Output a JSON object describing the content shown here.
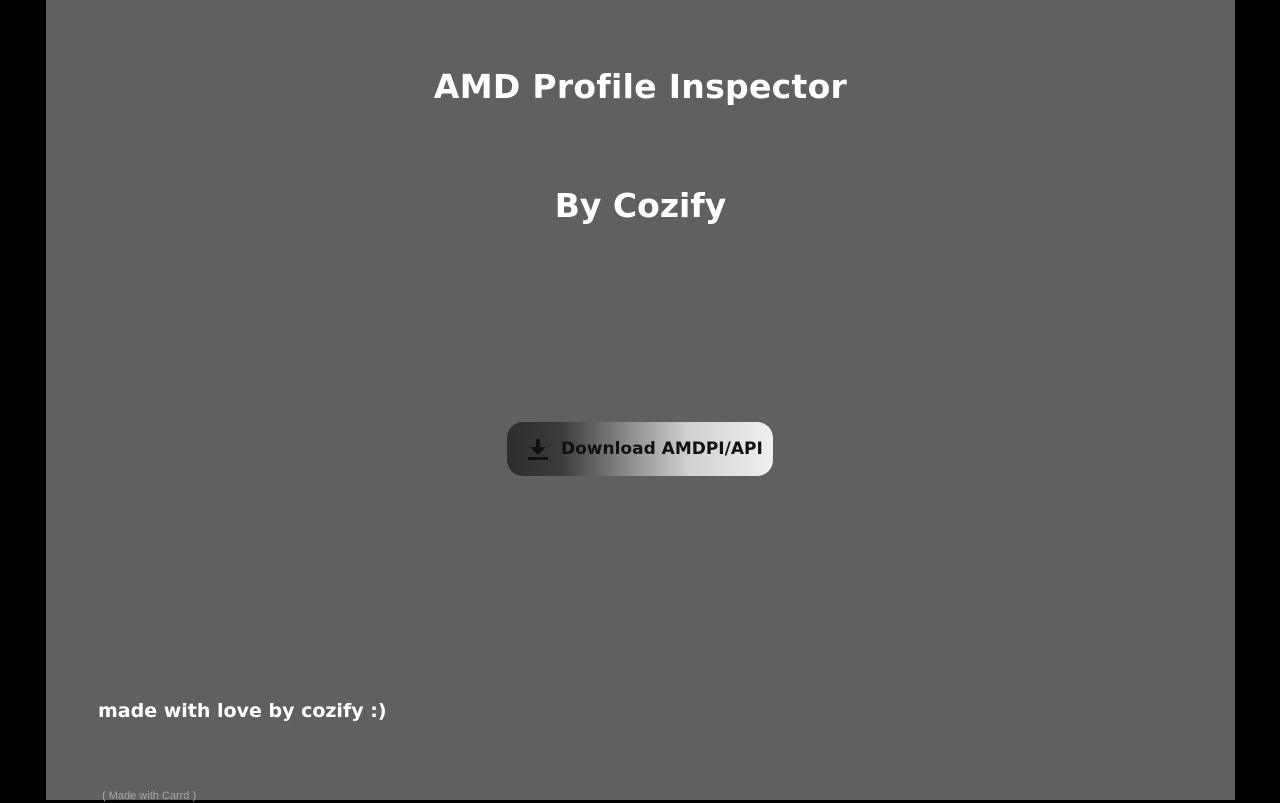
{
  "header": {
    "title": "AMD Profile Inspector",
    "subtitle": "By Cozify"
  },
  "download": {
    "label": "Download AMDPI/API",
    "icon": "download-icon"
  },
  "footer": {
    "love_text": "made with love by cozify :)",
    "carrd_open": "( ",
    "carrd_link": "Made with Carrd",
    "carrd_close": " )"
  },
  "colors": {
    "background": "#606060",
    "side_bars": "#000000",
    "text": "#ffffff",
    "button_text": "#111111"
  }
}
